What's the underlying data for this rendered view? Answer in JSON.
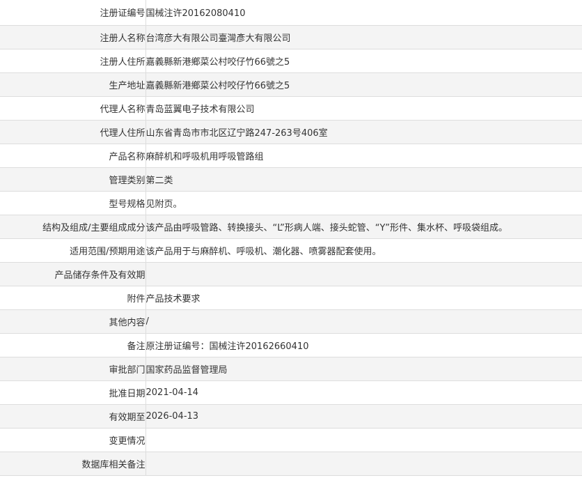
{
  "rows": [
    {
      "label": "注册证编号",
      "value": "国械注许20162080410"
    },
    {
      "label": "注册人名称",
      "value": "台湾彦大有限公司臺灣彥大有限公司"
    },
    {
      "label": "注册人住所",
      "value": "嘉義縣新港鄉菜公村咬仔竹66號之5"
    },
    {
      "label": "生产地址",
      "value": "嘉義縣新港鄉菜公村咬仔竹66號之5"
    },
    {
      "label": "代理人名称",
      "value": "青岛蓝翼电子技术有限公司"
    },
    {
      "label": "代理人住所",
      "value": "山东省青岛市市北区辽宁路247-263号406室"
    },
    {
      "label": "产品名称",
      "value": "麻醉机和呼吸机用呼吸管路组"
    },
    {
      "label": "管理类别",
      "value": "第二类"
    },
    {
      "label": "型号规格",
      "value": "见附页。"
    },
    {
      "label": "结构及组成/主要组成成分",
      "value": "该产品由呼吸管路、转换接头、“L”形病人端、接头蛇管、“Y”形件、集水杯、呼吸袋组成。"
    },
    {
      "label": "适用范围/预期用途",
      "value": "该产品用于与麻醉机、呼吸机、潮化器、喷雾器配套使用。"
    },
    {
      "label": "产品储存条件及有效期",
      "value": ""
    },
    {
      "label": "附件",
      "value": "产品技术要求"
    },
    {
      "label": "其他内容",
      "value": "/"
    },
    {
      "label": "备注",
      "value": "原注册证编号：国械注许20162660410"
    },
    {
      "label": "审批部门",
      "value": "国家药品监督管理局"
    },
    {
      "label": "批准日期",
      "value": "2021-04-14"
    },
    {
      "label": "有效期至",
      "value": "2026-04-13"
    },
    {
      "label": "变更情况",
      "value": ""
    },
    {
      "label": "数据库相关备注",
      "value": ""
    }
  ]
}
